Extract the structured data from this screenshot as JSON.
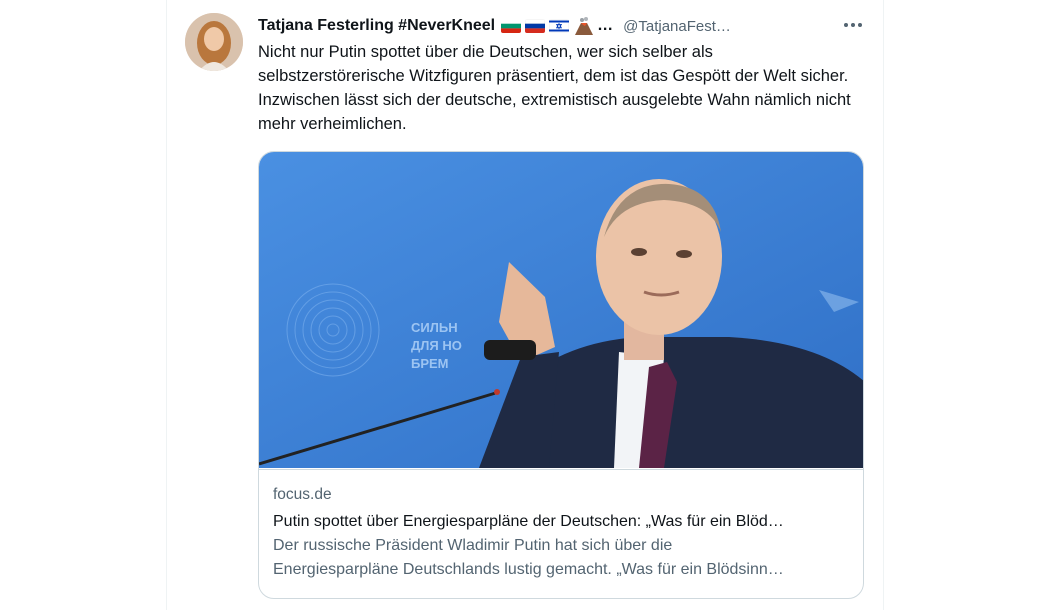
{
  "tweet": {
    "display_name": "Tatjana Festerling #NeverKneel",
    "name_ellipsis": "…",
    "handle": "@TatjanaFest…",
    "flags": [
      "bulgaria-flag",
      "russia-flag",
      "israel-flag",
      "volcano-emoji"
    ],
    "text": "Nicht nur Putin spottet über die Deutschen, wer sich selber als selbstzerstörerische Witzfiguren präsentiert, dem ist das Gespött der  Welt sicher. Inzwischen lässt sich der deutsche, extremistisch ausgelebte Wahn nämlich nicht mehr verheimlichen."
  },
  "card": {
    "domain": "focus.de",
    "title": "Putin spottet über Energiesparpläne der Deutschen: „Was für ein Blöd…",
    "description_line1": "Der russische Präsident Wladimir Putin hat sich über die",
    "description_line2": "Energiesparpläne Deutschlands lustig gemacht. „Was für ein Blödsinn…",
    "backdrop_text": [
      "СИЛЬН",
      "ДЛЯ НО",
      "БРЕМ"
    ]
  },
  "colors": {
    "text_primary": "#0f1419",
    "text_secondary": "#536471",
    "border": "#cfd9de",
    "backdrop_blue": "#3a7fd4"
  }
}
